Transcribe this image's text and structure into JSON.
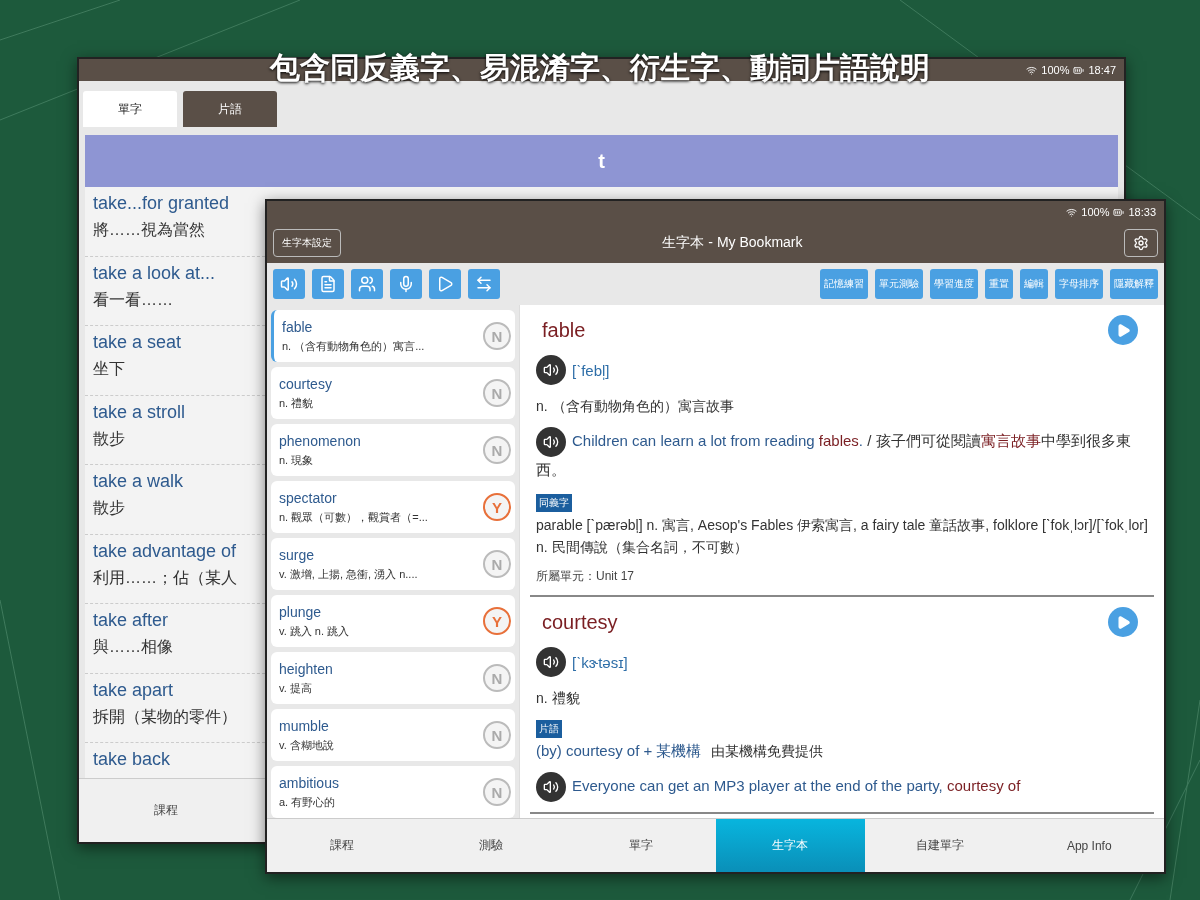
{
  "caption": "包含同反義字、易混淆字、衍生字、動詞片語說明",
  "back_window": {
    "status": {
      "battery": "100%",
      "time": "18:47"
    },
    "tabs": [
      {
        "label": "單字",
        "selected": true
      },
      {
        "label": "片語",
        "selected": false
      }
    ],
    "letter_bar": "t",
    "phrases": [
      {
        "phrase": "take...for granted",
        "meaning": "將……視為當然"
      },
      {
        "phrase": "take a look at...",
        "meaning": "看一看……"
      },
      {
        "phrase": "take a seat",
        "meaning": "坐下"
      },
      {
        "phrase": "take a stroll",
        "meaning": "散步"
      },
      {
        "phrase": "take a walk",
        "meaning": "散步"
      },
      {
        "phrase": "take advantage of",
        "meaning": "利用……；佔（某人"
      },
      {
        "phrase": "take after",
        "meaning": "與……相像"
      },
      {
        "phrase": "take apart",
        "meaning": "拆開（某物的零件）"
      },
      {
        "phrase": "take back"
      }
    ],
    "bottom_nav": [
      {
        "label": "課程",
        "selected": false
      }
    ]
  },
  "front_window": {
    "status": {
      "battery": "100%",
      "time": "18:33"
    },
    "settings_button": "生字本設定",
    "title": "生字本 - My Bookmark",
    "tool_buttons": [
      "記憶練習",
      "單元測驗",
      "學習進度",
      "重置",
      "編輯",
      "字母排序",
      "隱藏解釋"
    ],
    "words": [
      {
        "word": "fable",
        "meaning": "n. （含有動物角色的）寓言...",
        "mark": "N",
        "learned": false,
        "selected": true
      },
      {
        "word": "courtesy",
        "meaning": "n. 禮貌",
        "mark": "N",
        "learned": false,
        "selected": false
      },
      {
        "word": "phenomenon",
        "meaning": "n. 現象",
        "mark": "N",
        "learned": false,
        "selected": false
      },
      {
        "word": "spectator",
        "meaning": "n. 觀眾（可數），觀賞者（=...",
        "mark": "Y",
        "learned": true,
        "selected": false
      },
      {
        "word": "surge",
        "meaning": "v. 激增, 上揚, 急衝, 湧入 n....",
        "mark": "N",
        "learned": false,
        "selected": false
      },
      {
        "word": "plunge",
        "meaning": "v. 跳入 n. 跳入",
        "mark": "Y",
        "learned": true,
        "selected": false
      },
      {
        "word": "heighten",
        "meaning": "v. 提高",
        "mark": "N",
        "learned": false,
        "selected": false
      },
      {
        "word": "mumble",
        "meaning": "v. 含糊地說",
        "mark": "N",
        "learned": false,
        "selected": false
      },
      {
        "word": "ambitious",
        "meaning": "a. 有野心的",
        "mark": "N",
        "learned": false,
        "selected": false
      }
    ],
    "entries": [
      {
        "word": "fable",
        "blocks": [
          {
            "kind": "pronunciation",
            "text": "[ˋfebl̩]"
          },
          {
            "kind": "definition",
            "text": "n. （含有動物角色的）寓言故事"
          },
          {
            "kind": "example",
            "segments": [
              {
                "kind": "en",
                "text": "Children can learn a lot from reading "
              },
              {
                "kind": "hl",
                "text": "fables"
              },
              {
                "kind": "en",
                "text": ". "
              },
              {
                "kind": "zh",
                "text": "/ 孩子們可從閱讀"
              },
              {
                "kind": "hl",
                "text": "寓言故事"
              },
              {
                "kind": "zh",
                "text": "中學到很多東西。"
              }
            ]
          },
          {
            "kind": "tag",
            "text": "同義字"
          },
          {
            "kind": "text",
            "text": "parable [ˋpærəbl̩] n. 寓言, Aesop's Fables 伊索寓言, a fairy tale 童話故事, folklore [ˋfokˌlɔr]/[ˋfokˌlor] n. 民間傳說（集合名詞，不可數）"
          },
          {
            "kind": "unit",
            "text": "所屬單元：Unit 17"
          }
        ]
      },
      {
        "word": "courtesy",
        "blocks": [
          {
            "kind": "pronunciation",
            "text": "[ˋkɝtəsɪ]"
          },
          {
            "kind": "definition",
            "text": "n. 禮貌"
          },
          {
            "kind": "tag",
            "text": "片語"
          },
          {
            "kind": "phrase",
            "phrase": "(by) courtesy of + 某機構",
            "meaning": "由某機構免費提供"
          },
          {
            "kind": "example",
            "segments": [
              {
                "kind": "en",
                "text": "Everyone can get an MP3 player at the end of the party, "
              },
              {
                "kind": "hl",
                "text": "courtesy of"
              }
            ]
          }
        ]
      }
    ],
    "bottom_nav": [
      {
        "label": "課程",
        "selected": false
      },
      {
        "label": "測驗",
        "selected": false
      },
      {
        "label": "單字",
        "selected": false
      },
      {
        "label": "生字本",
        "selected": true
      },
      {
        "label": "自建單字",
        "selected": false
      },
      {
        "label": "App Info",
        "selected": false
      }
    ]
  }
}
